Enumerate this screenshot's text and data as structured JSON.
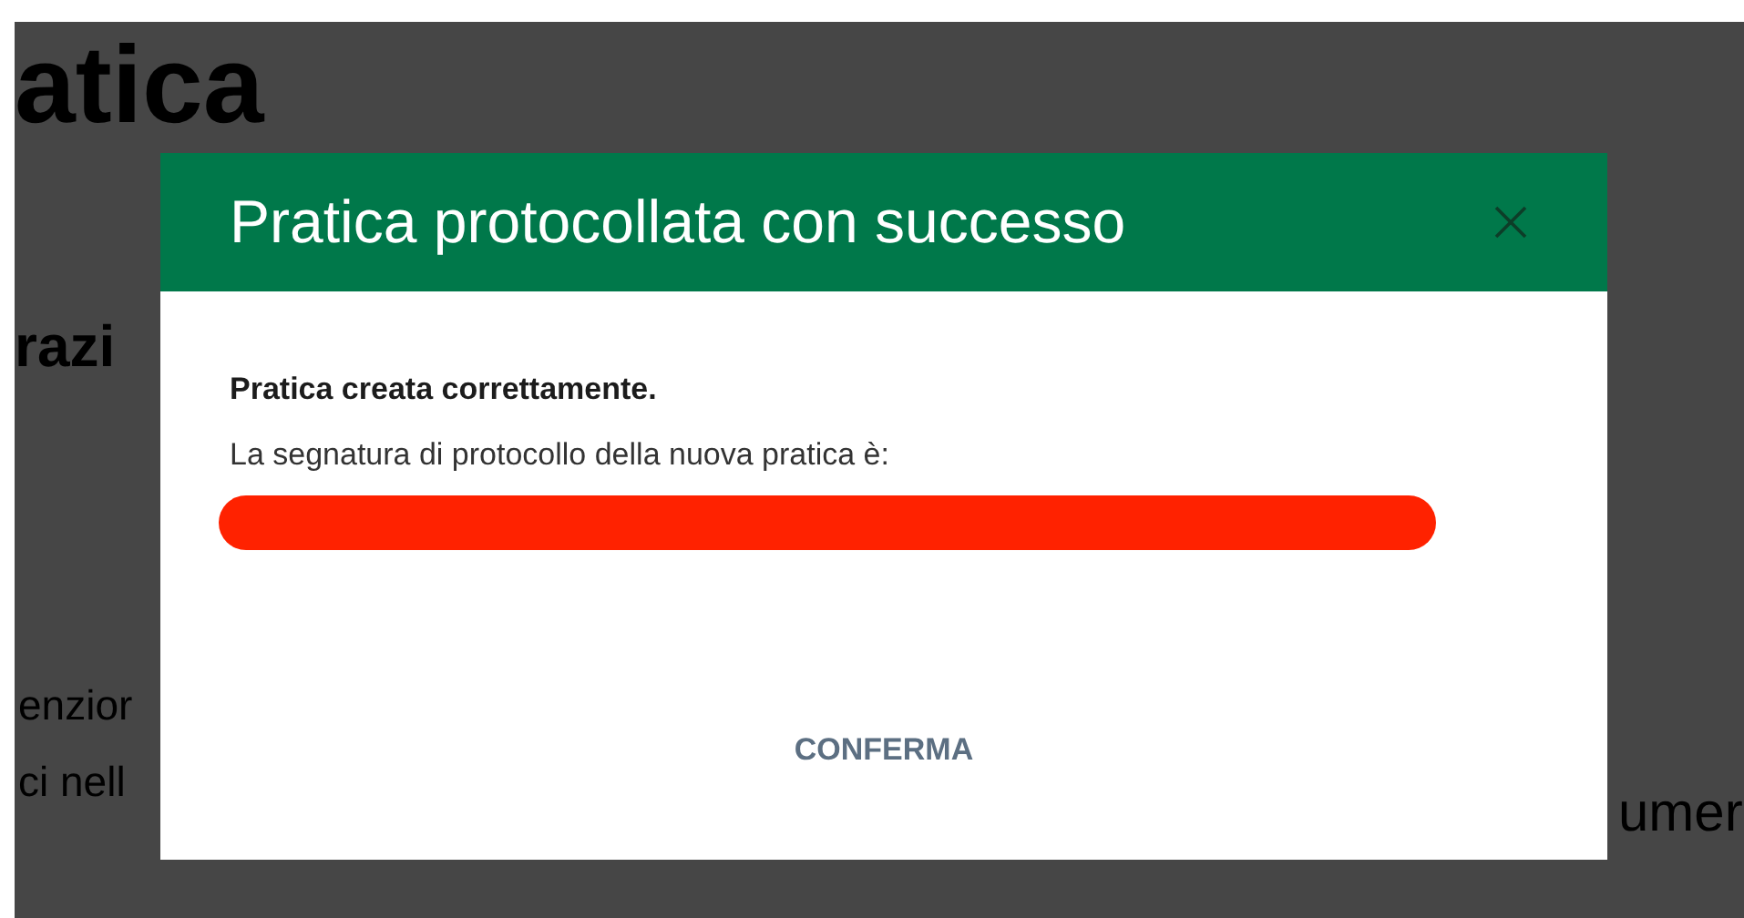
{
  "background_page": {
    "texts": [
      {
        "kind": "title",
        "text": "atica"
      },
      {
        "kind": "subtitle",
        "text": "razi"
      },
      {
        "kind": "body",
        "text": "enzior"
      },
      {
        "kind": "body",
        "text": "ci nell"
      },
      {
        "kind": "side",
        "text": "umer"
      }
    ]
  },
  "dialog": {
    "title": "Pratica protocollata con successo",
    "heading": "Pratica creata correttamente.",
    "message": "La segnatura di protocollo della nuova pratica è:",
    "confirm_button": "CONFERMA"
  }
}
